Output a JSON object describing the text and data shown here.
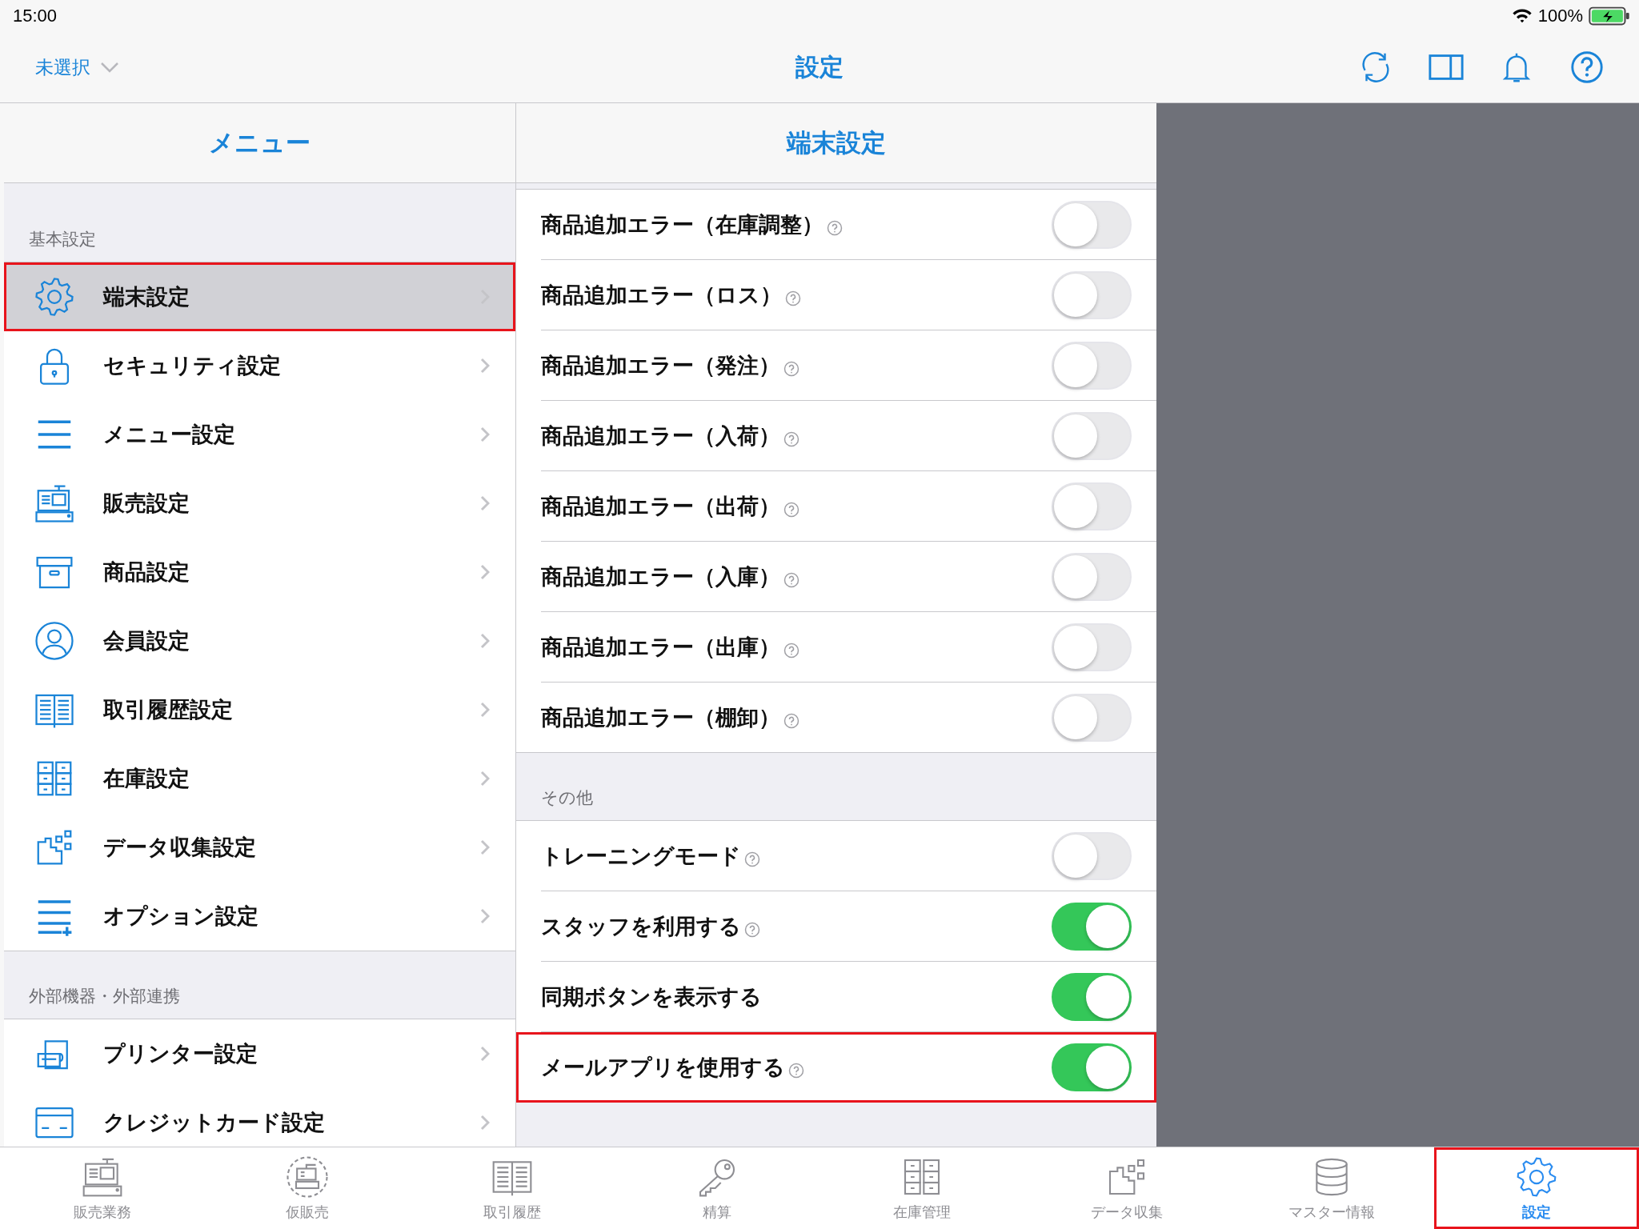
{
  "status_bar": {
    "time": "15:00",
    "battery": "100%"
  },
  "nav_bar": {
    "store_selector": "未選択",
    "title": "設定"
  },
  "menu": {
    "title": "メニュー",
    "sections": [
      {
        "header": "基本設定",
        "items": [
          {
            "label": "端末設定",
            "selected": true,
            "highlighted": true
          },
          {
            "label": "セキュリティ設定",
            "selected": false,
            "highlighted": false
          },
          {
            "label": "メニュー設定",
            "selected": false,
            "highlighted": false
          },
          {
            "label": "販売設定",
            "selected": false,
            "highlighted": false
          },
          {
            "label": "商品設定",
            "selected": false,
            "highlighted": false
          },
          {
            "label": "会員設定",
            "selected": false,
            "highlighted": false
          },
          {
            "label": "取引履歴設定",
            "selected": false,
            "highlighted": false
          },
          {
            "label": "在庫設定",
            "selected": false,
            "highlighted": false
          },
          {
            "label": "データ収集設定",
            "selected": false,
            "highlighted": false
          },
          {
            "label": "オプション設定",
            "selected": false,
            "highlighted": false
          }
        ]
      },
      {
        "header": "外部機器・外部連携",
        "items": [
          {
            "label": "プリンター設定",
            "selected": false,
            "highlighted": false
          },
          {
            "label": "クレジットカード設定",
            "selected": false,
            "highlighted": false
          }
        ]
      }
    ]
  },
  "detail": {
    "title": "端末設定",
    "sections": [
      {
        "items": [
          {
            "label": "商品追加エラー（在庫調整）",
            "help": true,
            "on": false,
            "highlighted": false
          },
          {
            "label": "商品追加エラー（ロス）",
            "help": true,
            "on": false,
            "highlighted": false
          },
          {
            "label": "商品追加エラー（発注）",
            "help": true,
            "on": false,
            "highlighted": false
          },
          {
            "label": "商品追加エラー（入荷）",
            "help": true,
            "on": false,
            "highlighted": false
          },
          {
            "label": "商品追加エラー（出荷）",
            "help": true,
            "on": false,
            "highlighted": false
          },
          {
            "label": "商品追加エラー（入庫）",
            "help": true,
            "on": false,
            "highlighted": false
          },
          {
            "label": "商品追加エラー（出庫）",
            "help": true,
            "on": false,
            "highlighted": false
          },
          {
            "label": "商品追加エラー（棚卸）",
            "help": true,
            "on": false,
            "highlighted": false
          }
        ]
      },
      {
        "header": "その他",
        "items": [
          {
            "label": "トレーニングモード",
            "help": true,
            "on": false,
            "highlighted": false
          },
          {
            "label": "スタッフを利用する",
            "help": true,
            "on": true,
            "highlighted": false
          },
          {
            "label": "同期ボタンを表示する",
            "help": false,
            "on": true,
            "highlighted": false
          },
          {
            "label": "メールアプリを使用する",
            "help": true,
            "on": true,
            "highlighted": true
          }
        ]
      }
    ]
  },
  "tab_bar": {
    "tabs": [
      {
        "label": "販売業務",
        "selected": false,
        "highlighted": false
      },
      {
        "label": "仮販売",
        "selected": false,
        "highlighted": false
      },
      {
        "label": "取引履歴",
        "selected": false,
        "highlighted": false
      },
      {
        "label": "精算",
        "selected": false,
        "highlighted": false
      },
      {
        "label": "在庫管理",
        "selected": false,
        "highlighted": false
      },
      {
        "label": "データ収集",
        "selected": false,
        "highlighted": false
      },
      {
        "label": "マスター情報",
        "selected": false,
        "highlighted": false
      },
      {
        "label": "設定",
        "selected": true,
        "highlighted": true
      }
    ]
  }
}
